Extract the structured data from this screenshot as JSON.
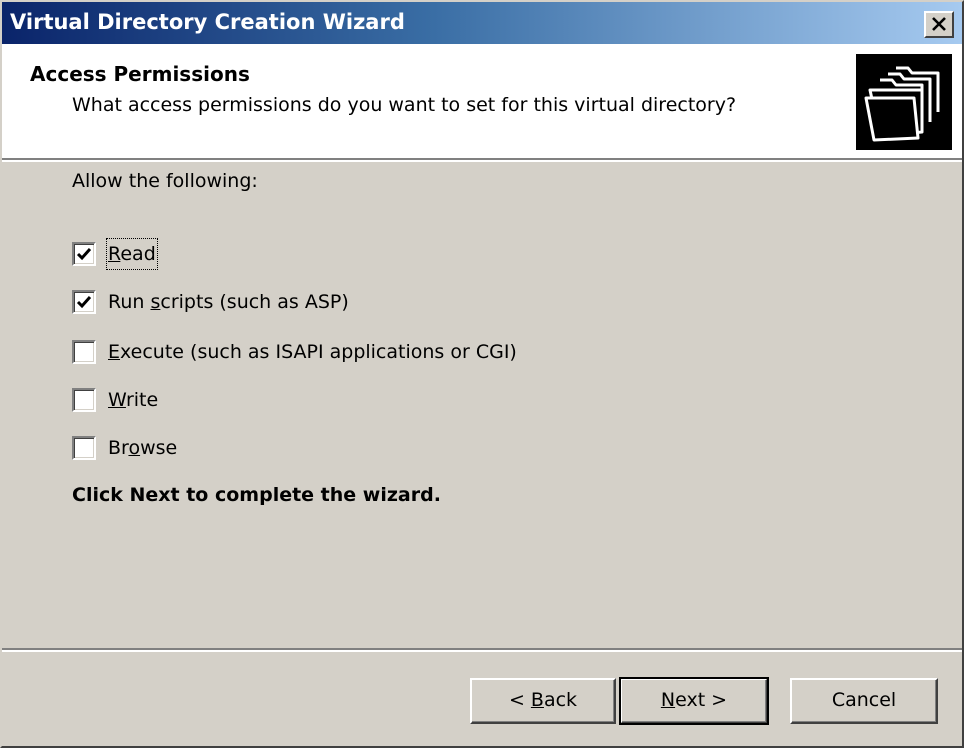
{
  "window": {
    "title": "Virtual Directory Creation Wizard",
    "close_icon": "close-icon"
  },
  "header": {
    "title": "Access Permissions",
    "subtitle": "What access permissions do you want to set for this virtual directory?",
    "icon": "folders-icon"
  },
  "content": {
    "intro": "Allow the following:",
    "options": [
      {
        "label_pre": "",
        "label_accel": "R",
        "label_post": "ead",
        "checked": true
      },
      {
        "label_pre": "Run ",
        "label_accel": "s",
        "label_post": "cripts (such as ASP)",
        "checked": true
      },
      {
        "label_pre": "",
        "label_accel": "E",
        "label_post": "xecute (such as ISAPI applications or CGI)",
        "checked": false
      },
      {
        "label_pre": "",
        "label_accel": "W",
        "label_post": "rite",
        "checked": false
      },
      {
        "label_pre": "Br",
        "label_accel": "o",
        "label_post": "wse",
        "checked": false
      }
    ],
    "footer_note": "Click Next to complete the wizard."
  },
  "buttons": {
    "back": {
      "pre": "< ",
      "accel": "B",
      "post": "ack"
    },
    "next": {
      "pre": "",
      "accel": "N",
      "post": "ext >"
    },
    "cancel": "Cancel"
  }
}
